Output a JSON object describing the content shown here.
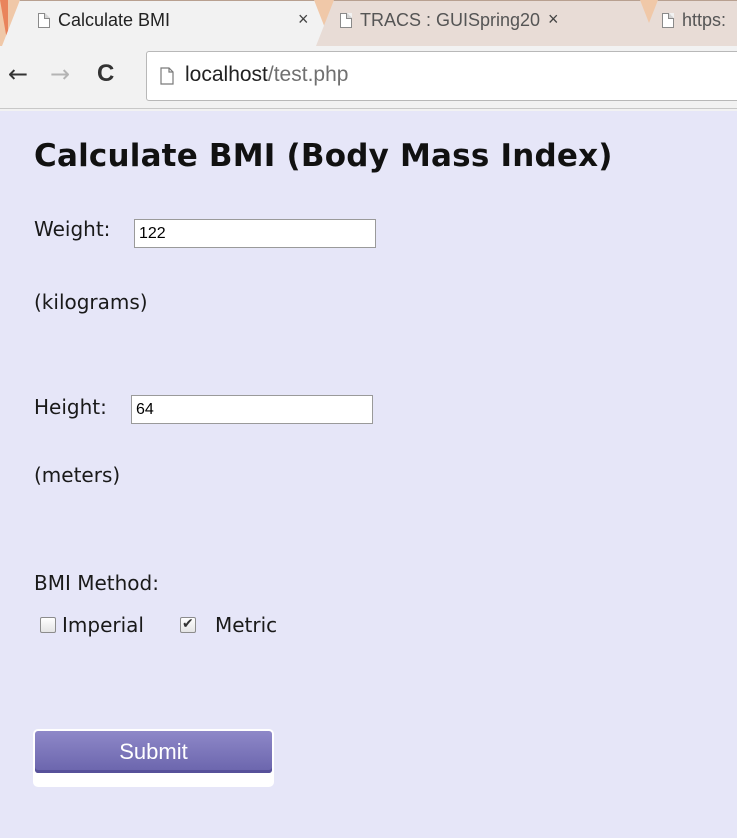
{
  "browser": {
    "tabs": [
      {
        "title": "Calculate BMI",
        "close": "×",
        "active": true
      },
      {
        "title": "TRACS : GUISpring20",
        "close": "×",
        "active": false
      },
      {
        "title": "https:",
        "close": "",
        "active": false
      }
    ],
    "nav": {
      "back_icon": "←",
      "forward_icon": "→",
      "reload_icon": "C"
    },
    "url": {
      "host": "localhost",
      "path": "/test.php"
    }
  },
  "page": {
    "title": "Calculate BMI (Body Mass Index)",
    "weight": {
      "label": "Weight:",
      "value": "122",
      "unit": "(kilograms)"
    },
    "height": {
      "label": "Height:",
      "value": "64",
      "unit": "(meters)"
    },
    "method": {
      "label": "BMI Method:",
      "options": [
        {
          "label": "Imperial",
          "checked": false
        },
        {
          "label": "Metric",
          "checked": true
        }
      ]
    },
    "submit_label": "Submit"
  },
  "colors": {
    "page_background": "#e6e6f8",
    "button_color": "#7a74bc",
    "tabstrip_color": "#f0c8a8"
  }
}
